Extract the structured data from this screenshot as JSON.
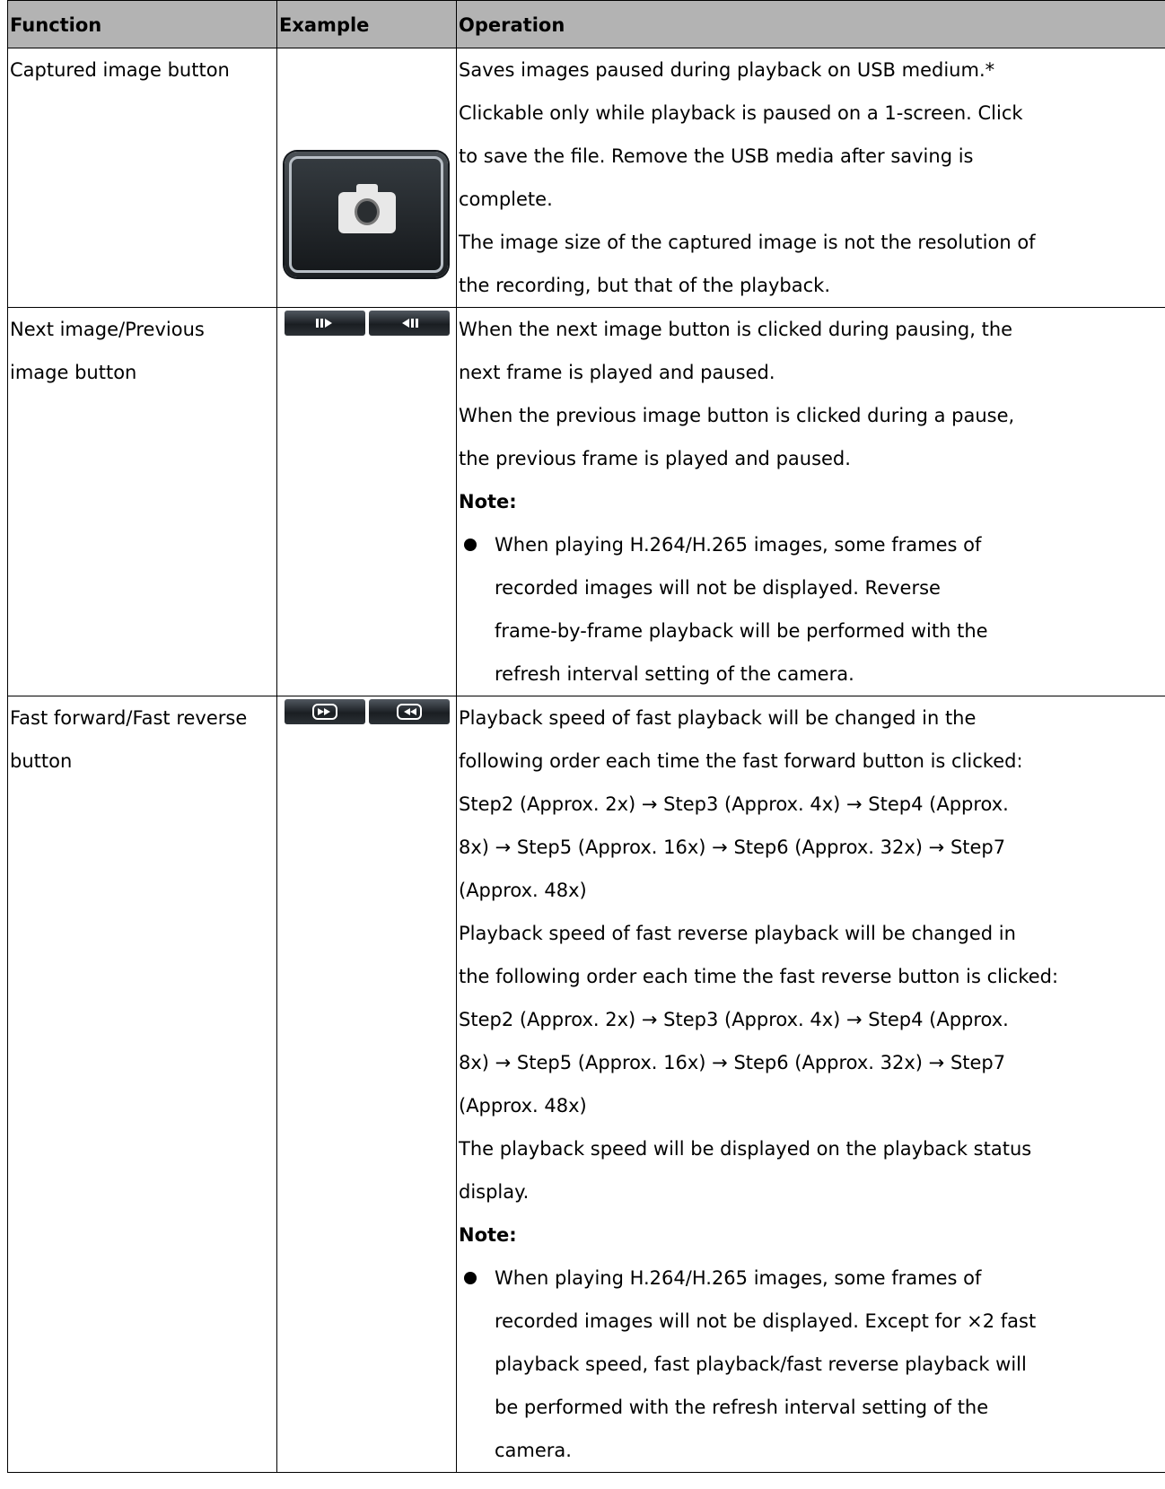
{
  "table": {
    "headers": [
      "Function",
      "Example",
      "Operation"
    ],
    "rows": [
      {
        "function_lines": [
          "Captured image button"
        ],
        "example_icon": "camera-capture-button-icon",
        "operation_lines": [
          "Saves images paused during playback on USB medium.*",
          "Clickable only while playback is paused on a 1-screen. Click",
          "to save the file. Remove the USB media after saving is",
          "complete.",
          "The image size of the captured image is not the resolution of",
          "the recording, but that of the playback."
        ]
      },
      {
        "function_lines": [
          "Next image/Previous",
          "image button"
        ],
        "example_icons": [
          "next-image-icon",
          "previous-image-icon"
        ],
        "operation_lines": [
          "When the next image button is clicked during pausing, the",
          "next frame is played and paused.",
          "When the previous image button is clicked during a pause,",
          "the previous frame is played and paused."
        ],
        "note_label": "Note:",
        "note_lines": [
          "When playing H.264/H.265 images, some frames of",
          "recorded images will not be displayed. Reverse",
          "frame-by-frame playback will be performed with the",
          "refresh interval setting of the camera."
        ]
      },
      {
        "function_lines": [
          "Fast forward/Fast reverse",
          "button"
        ],
        "example_icons": [
          "fast-forward-icon",
          "fast-reverse-icon"
        ],
        "operation_lines": [
          "Playback speed of fast playback will be changed in the",
          "following order each time the fast forward button is clicked:",
          "Step2 (Approx. 2x) → Step3 (Approx. 4x) → Step4 (Approx.",
          "8x) → Step5 (Approx. 16x) → Step6 (Approx. 32x) → Step7",
          "(Approx. 48x)",
          "Playback speed of fast reverse playback will be changed in",
          "the following order each time the fast reverse button is clicked:",
          "Step2 (Approx. 2x) → Step3 (Approx. 4x) → Step4 (Approx.",
          "8x) → Step5 (Approx. 16x) → Step6 (Approx. 32x) → Step7",
          "(Approx. 48x)",
          "The playback speed will be displayed on the playback status",
          "display."
        ],
        "note_label": "Note:",
        "note_lines": [
          "When playing H.264/H.265 images, some frames of",
          "recorded images will not be displayed. Except for ×2 fast",
          "playback speed, fast playback/fast reverse playback will",
          "be performed with the refresh interval setting of the",
          "camera."
        ]
      }
    ]
  }
}
